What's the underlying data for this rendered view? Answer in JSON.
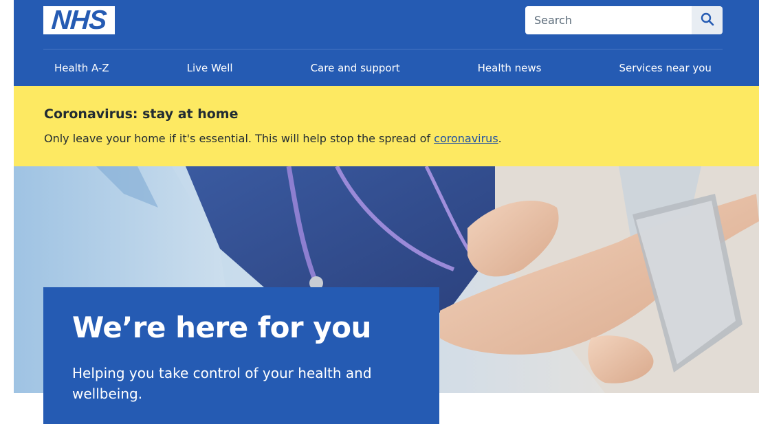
{
  "header": {
    "logo_text": "NHS",
    "search": {
      "placeholder": "Search",
      "button_icon": "search-icon"
    },
    "nav": [
      {
        "label": "Health A-Z"
      },
      {
        "label": "Live Well"
      },
      {
        "label": "Care and support"
      },
      {
        "label": "Health news"
      },
      {
        "label": "Services near you"
      }
    ]
  },
  "alert": {
    "title": "Coronavirus: stay at home",
    "text": "Only leave your home if it's essential. This will help stop the spread of ",
    "link_text": "coronavirus",
    "text_end": "."
  },
  "hero": {
    "title": "We’re here for you",
    "subtitle": "Helping you take control of your health and wellbeing."
  },
  "colors": {
    "nhs_blue": "#255bb3",
    "alert_yellow": "#fde962",
    "text_dark": "#212b32",
    "link": "#1d4fa3"
  }
}
